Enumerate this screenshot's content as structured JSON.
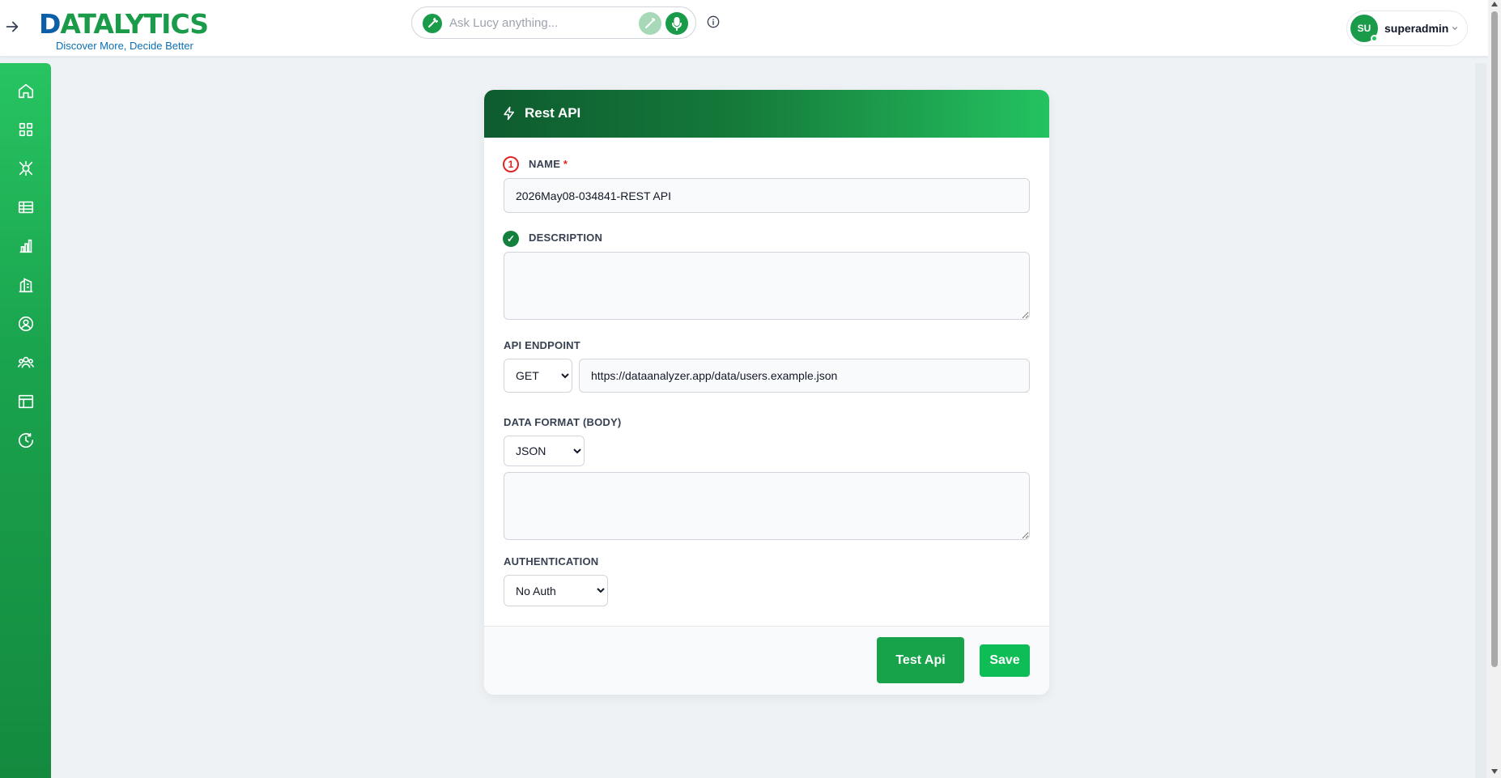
{
  "header": {
    "logo_text": "DATALYTICS",
    "logo_tagline": "Discover More, Decide Better",
    "search_placeholder": "Ask Lucy anything...",
    "user_initials": "SU",
    "user_name": "superadmin"
  },
  "sidebar": {
    "items": [
      {
        "icon": "home-icon"
      },
      {
        "icon": "grid-icon"
      },
      {
        "icon": "connector-icon"
      },
      {
        "icon": "table-icon"
      },
      {
        "icon": "bar-chart-icon"
      },
      {
        "icon": "building-icon"
      },
      {
        "icon": "user-circle-icon"
      },
      {
        "icon": "users-icon"
      },
      {
        "icon": "layout-icon"
      },
      {
        "icon": "history-icon"
      }
    ]
  },
  "form": {
    "title": "Rest API",
    "name_step": "1",
    "name_label": "NAME",
    "name_required": "*",
    "name_value": "2026May08-034841-REST API",
    "description_step": "✓",
    "description_label": "DESCRIPTION",
    "description_value": "",
    "endpoint_label": "API ENDPOINT",
    "method_selected": "GET",
    "endpoint_url": "https://dataanalyzer.app/data/users.example.json",
    "data_format_label": "DATA FORMAT (BODY)",
    "data_format_selected": "JSON",
    "body_value": "",
    "auth_label": "AUTHENTICATION",
    "auth_selected": "No Auth",
    "test_button": "Test Api",
    "save_button": "Save"
  },
  "colors": {
    "brand_green": "#1a9b4a",
    "header_dark": "#0e5b2f",
    "error_red": "#dc2626"
  }
}
